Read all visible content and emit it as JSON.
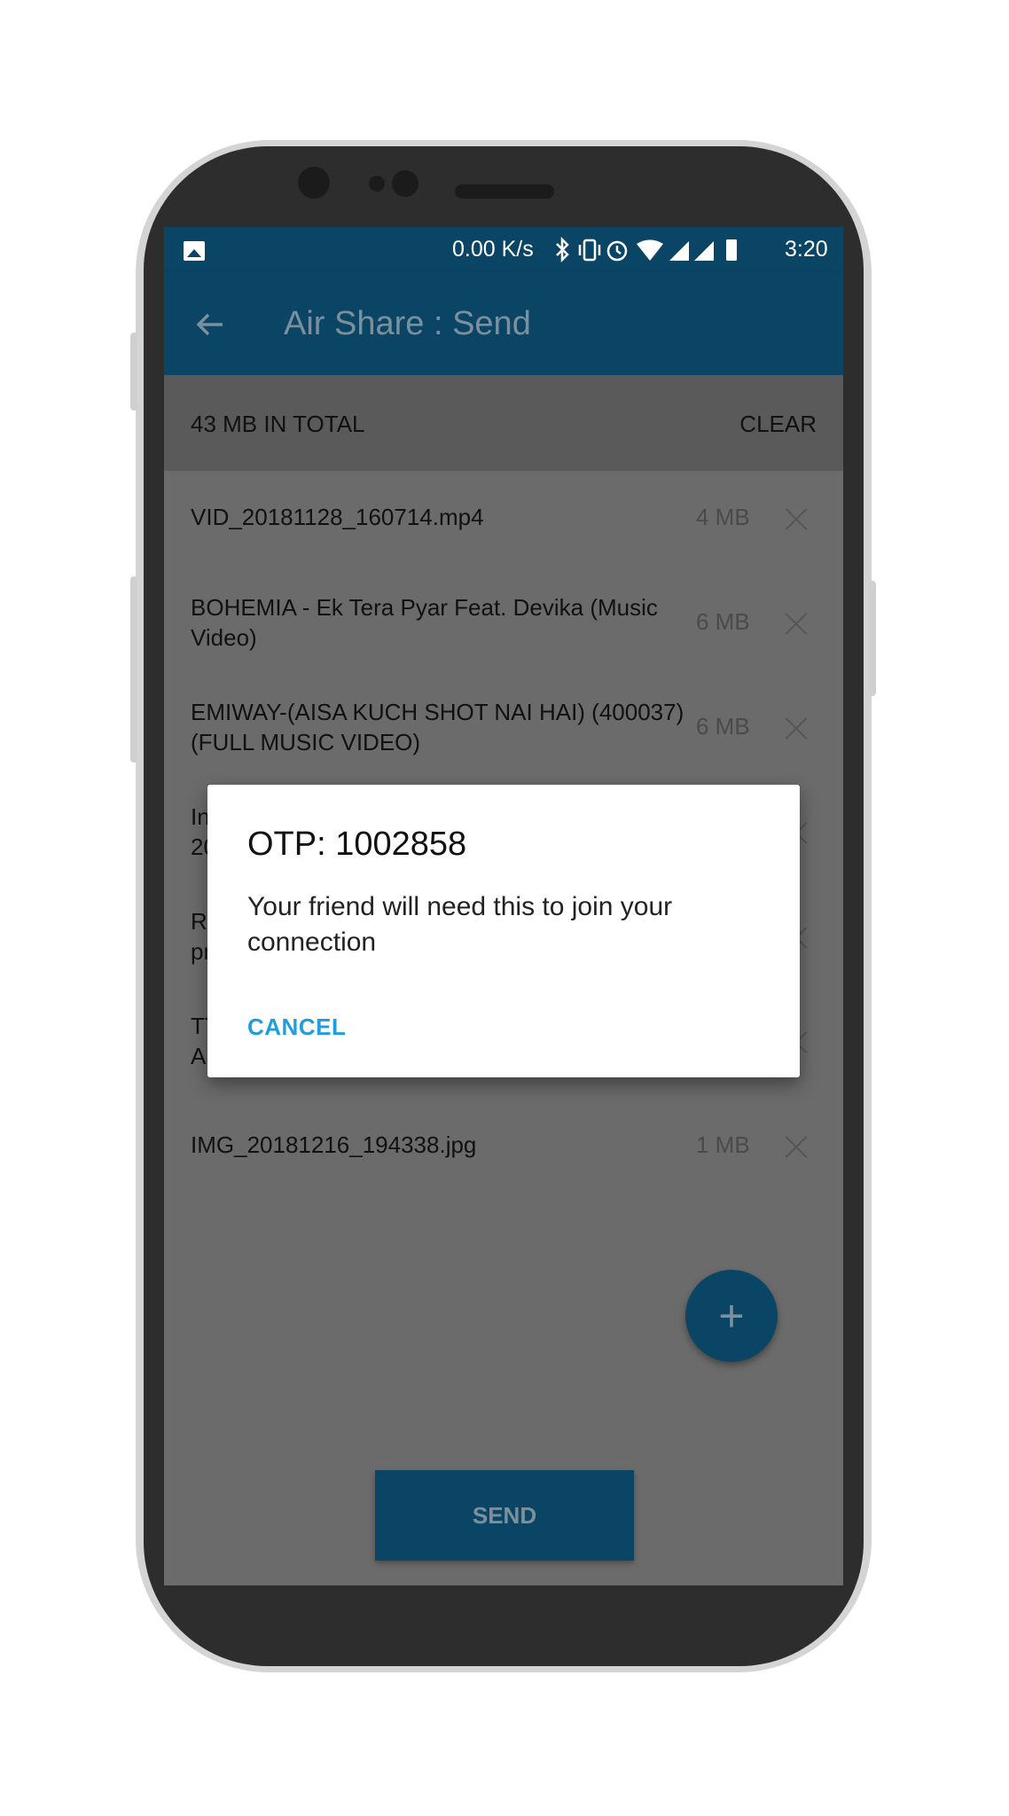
{
  "status_bar": {
    "speed": "0.00 K/s",
    "time": "3:20",
    "icons": [
      "image-icon",
      "bluetooth-icon",
      "vibrate-icon",
      "alarm-icon",
      "wifi-icon",
      "signal-icon",
      "battery-icon"
    ]
  },
  "app_bar": {
    "title": "Air Share : Send",
    "back_icon": "arrow-left-icon"
  },
  "summary": {
    "total": "43 MB IN TOTAL",
    "clear": "CLEAR"
  },
  "files": [
    {
      "name": "VID_20181128_160714.mp4",
      "size": "4 MB"
    },
    {
      "name": "BOHEMIA - Ek Tera Pyar Feat. Devika  (Music Video)",
      "size": "6 MB"
    },
    {
      "name": "EMIWAY-(AISA KUCH SHOT NAI HAI) (400037) (FULL MUSIC VIDEO)",
      "size": "6 MB"
    },
    {
      "name": "In 20",
      "size": ""
    },
    {
      "name": "Ra pr",
      "size": ""
    },
    {
      "name": "TT A",
      "size": ""
    },
    {
      "name": "IMG_20181216_194338.jpg",
      "size": "1 MB"
    }
  ],
  "fab": {
    "label": "+"
  },
  "send": {
    "label": "SEND"
  },
  "dialog": {
    "title": "OTP: 1002858",
    "message": "Your friend will need this to join your connection",
    "cancel": "CANCEL"
  },
  "colors": {
    "primary": "#0b4565",
    "accent": "#1e9de0",
    "scrim_background": "#6b6b6b"
  }
}
